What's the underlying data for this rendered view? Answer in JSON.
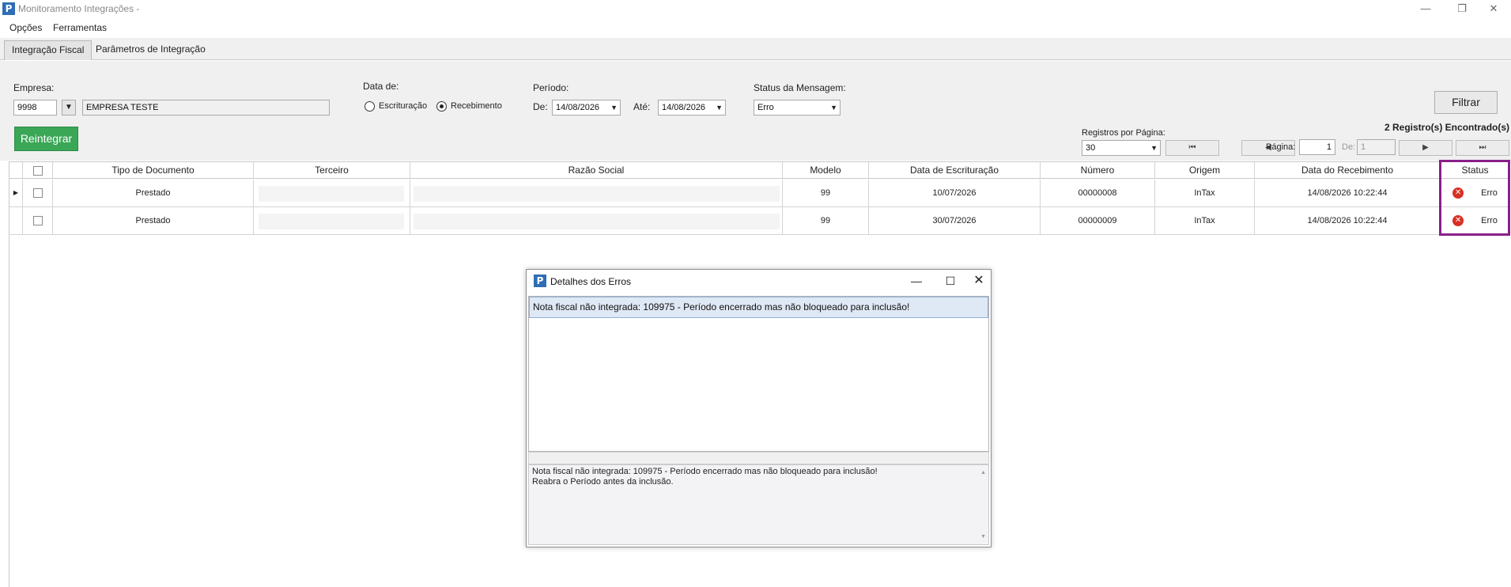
{
  "window": {
    "title": "Monitoramento Integrações -",
    "app_icon": "P"
  },
  "menu": {
    "opcoes": "Opções",
    "ferramentas": "Ferramentas"
  },
  "tabs": [
    {
      "label": "Integração Fiscal",
      "active": true
    },
    {
      "label": "Parâmetros de Integração",
      "active": false
    }
  ],
  "form": {
    "empresa_label": "Empresa:",
    "empresa_code": "9998",
    "empresa_name": "EMPRESA TESTE",
    "data_de_label": "Data de:",
    "radio_escrituracao": "Escrituração",
    "radio_recebimento": "Recebimento",
    "periodo_label": "Período:",
    "de_label": "De:",
    "de_value": "14/08/2026",
    "ate_label": "Até:",
    "ate_value": "14/08/2026",
    "status_label": "Status da Mensagem:",
    "status_value": "Erro",
    "filtrar_label": "Filtrar",
    "reintegrar_label": "Reintegrar",
    "registros_label": "Registros por Página:",
    "registros_value": "30",
    "pagina_label": "Página:",
    "pagina_value": "1",
    "de_pages_label": "De:",
    "de_pages_value": "1",
    "found_label": "2 Registro(s) Encontrado(s)"
  },
  "grid": {
    "columns": [
      "Tipo de Documento",
      "Terceiro",
      "Razão Social",
      "Modelo",
      "Data de Escrituração",
      "Número",
      "Origem",
      "Data do Recebimento",
      "Status"
    ],
    "rows": [
      {
        "tipo": "Prestado",
        "terceiro": "",
        "razao": "",
        "modelo": "99",
        "data_esc": "10/07/2026",
        "numero": "00000008",
        "origem": "InTax",
        "data_rec": "14/08/2026 10:22:44",
        "status": "Erro"
      },
      {
        "tipo": "Prestado",
        "terceiro": "",
        "razao": "",
        "modelo": "99",
        "data_esc": "30/07/2026",
        "numero": "00000009",
        "origem": "InTax",
        "data_rec": "14/08/2026 10:22:44",
        "status": "Erro"
      }
    ]
  },
  "dialog": {
    "title": "Detalhes dos Erros",
    "list_item": "Nota fiscal não integrada: 109975 - Período encerrado mas não bloqueado para inclusão!",
    "detail_line1": "Nota fiscal não integrada: 109975 - Período encerrado mas não bloqueado para inclusão!",
    "detail_line2": "Reabra o Período antes da inclusão."
  },
  "colors": {
    "accent_green": "#3aa757",
    "error_red": "#d93025",
    "highlight_purple": "#8a1f8a",
    "selection_blue": "#dfe8f5"
  }
}
